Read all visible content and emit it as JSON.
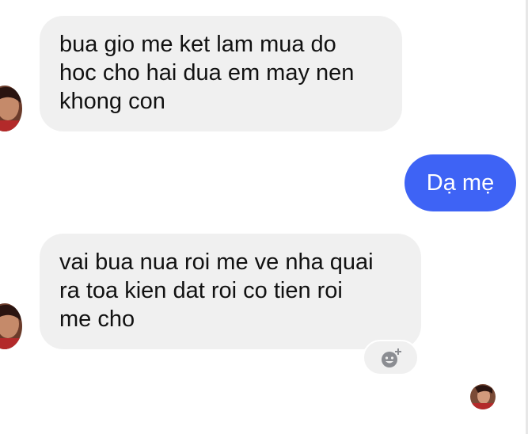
{
  "conversation": {
    "messages": [
      {
        "direction": "incoming",
        "text": "bua gio me ket lam mua do\nhoc cho hai dua em may nen\nkhong con"
      },
      {
        "direction": "outgoing",
        "text": "Dạ mẹ"
      },
      {
        "direction": "incoming",
        "text": "vai bua nua roi me ve nha quai\nra toa kien dat roi co tien roi\nme cho"
      }
    ]
  },
  "icons": {
    "avatar_contact": "contact-avatar",
    "reaction": "add-reaction-icon",
    "seen": "seen-avatar"
  },
  "colors": {
    "incoming_bubble": "#f0f0f0",
    "outgoing_bubble": "#3e63f5",
    "outgoing_text": "#ffffff",
    "text": "#111111"
  }
}
